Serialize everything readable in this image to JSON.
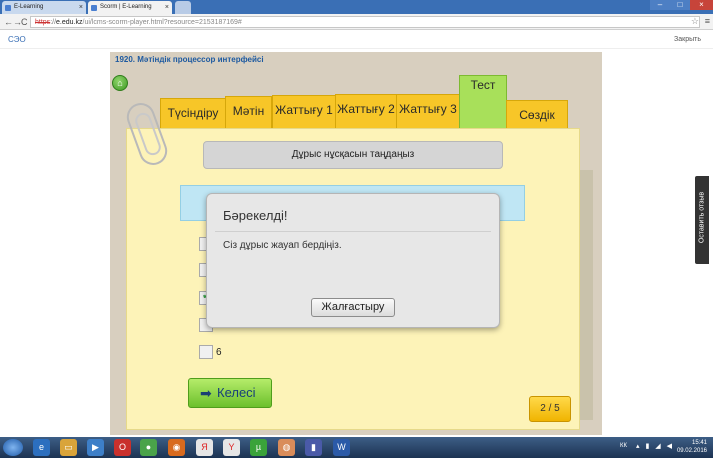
{
  "browser": {
    "tabs": [
      {
        "label": "E-Learning",
        "active": false
      },
      {
        "label": "Scorm | E-Learning",
        "active": true
      }
    ],
    "url": {
      "scheme": "https",
      "host": "e.edu.kz",
      "path": "/ui/lcms-scorm-player.html?resource=2153187169#"
    }
  },
  "site": {
    "logo": "СЭО",
    "close_link": "Закрыть"
  },
  "lesson": {
    "title": "1920. Мәтіндік процессор интерфейсі",
    "tabs": [
      "Түсіндіру",
      "Мәтін",
      "Жаттығу 1",
      "Жаттығу 2",
      "Жаттығу 3",
      "Тест",
      "Сөздік"
    ],
    "active_tab": "Тест",
    "instruction": "Дұрыс нұсқасын таңдаңыз",
    "visible_option": "6",
    "next_button": "Келесі",
    "page_counter": "2 / 5"
  },
  "modal": {
    "title": "Бәрекелді!",
    "message": "Сіз дұрыс жауап бердіңіз.",
    "continue_button": "Жалғастыру"
  },
  "feedback_tab": "Оставить отзыв",
  "taskbar": {
    "language": "КК",
    "time": "15:41",
    "date": "09.02.2016"
  },
  "colors": {
    "tab_yellow": "#f7c628",
    "tab_active_green": "#a8e05a",
    "next_button_green": "#6cc02c",
    "notebook": "#fdf3b8"
  }
}
